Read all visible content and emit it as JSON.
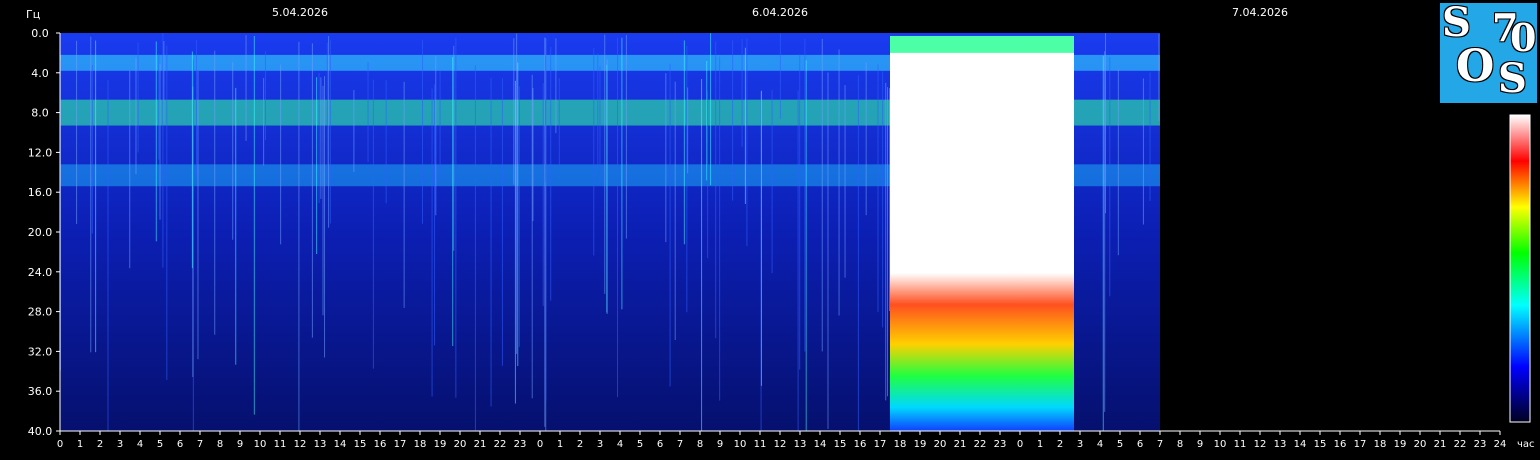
{
  "chart_data": {
    "type": "heatmap",
    "title": "",
    "y_unit_label": "Гц",
    "x_unit_label": "час",
    "y_ticks": [
      "0.0",
      "4.0",
      "8.0",
      "12.0",
      "16.0",
      "20.0",
      "24.0",
      "28.0",
      "32.0",
      "36.0",
      "40.0"
    ],
    "ylim": [
      0,
      40
    ],
    "x_ticks": [
      "0",
      "1",
      "2",
      "3",
      "4",
      "5",
      "6",
      "7",
      "8",
      "9",
      "10",
      "11",
      "12",
      "13",
      "14",
      "15",
      "16",
      "17",
      "18",
      "19",
      "20",
      "21",
      "22",
      "23",
      "0",
      "1",
      "2",
      "3",
      "4",
      "5",
      "6",
      "7",
      "8",
      "9",
      "10",
      "11",
      "12",
      "13",
      "14",
      "15",
      "16",
      "17",
      "18",
      "19",
      "20",
      "21",
      "22",
      "23",
      "0",
      "1",
      "2",
      "3",
      "4",
      "5",
      "6",
      "7",
      "8",
      "9",
      "10",
      "11",
      "12",
      "13",
      "14",
      "15",
      "16",
      "17",
      "18",
      "19",
      "20",
      "21",
      "22",
      "23",
      "24"
    ],
    "xlim_hours": [
      0,
      72
    ],
    "dates": [
      {
        "label": "5.04.2026",
        "start_hour": 0
      },
      {
        "label": "6.04.2026",
        "start_hour": 24
      },
      {
        "label": "7.04.2026",
        "start_hour": 48
      }
    ],
    "data_coverage_hours": [
      0,
      55
    ],
    "bands_hz": [
      3.0,
      8.0,
      14.3
    ],
    "intense_burst_hours": [
      41.5,
      50.7
    ],
    "grid": false,
    "colorbar": [
      "#000020",
      "#0000ff",
      "#00ffff",
      "#00ff00",
      "#ffff00",
      "#ff0000",
      "#ffffff"
    ]
  },
  "logo": {
    "letters": [
      "S",
      "7",
      "0",
      "O",
      "S"
    ]
  },
  "colors": {
    "background": "#000000",
    "logo": "#23a7e6",
    "text": "#ffffff"
  }
}
